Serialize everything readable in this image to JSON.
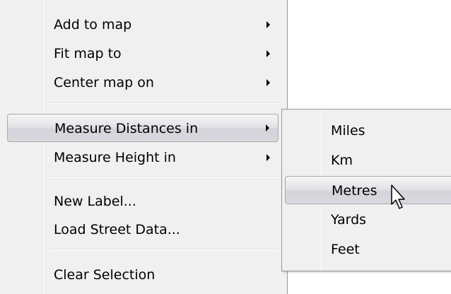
{
  "context_menu": {
    "items": [
      {
        "label": "Add to map",
        "has_submenu": true
      },
      {
        "label": "Fit map to",
        "has_submenu": true
      },
      {
        "label": "Center map on",
        "has_submenu": true
      },
      {
        "label": "Measure Distances in",
        "has_submenu": true,
        "state": "highlighted"
      },
      {
        "label": "Measure Height in",
        "has_submenu": true
      },
      {
        "label": "New Label...",
        "has_submenu": false
      },
      {
        "label": "Load Street Data...",
        "has_submenu": false
      },
      {
        "label": "Clear Selection",
        "has_submenu": false
      }
    ]
  },
  "distance_submenu": {
    "items": [
      {
        "label": "Miles"
      },
      {
        "label": "Km"
      },
      {
        "label": "Metres",
        "state": "highlighted"
      },
      {
        "label": "Yards"
      },
      {
        "label": "Feet"
      }
    ]
  },
  "icons": {
    "submenu_arrow": "chevron-right-icon",
    "cursor": "mouse-pointer-icon"
  },
  "colors": {
    "menu_background": "#f0f0f0",
    "menu_border": "#979797",
    "highlight_border": "#a8a8a8",
    "highlight_fill": "#e3e3e7"
  }
}
